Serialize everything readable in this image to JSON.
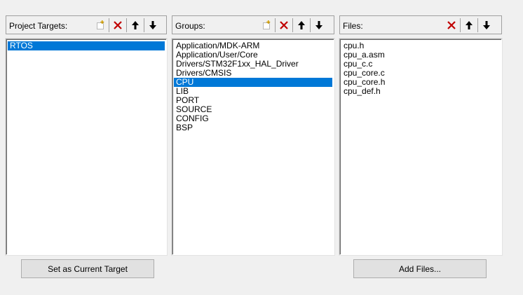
{
  "panels": {
    "targets": {
      "title": "Project Targets:",
      "items": [
        "RTOS"
      ],
      "selected_index": 0
    },
    "groups": {
      "title": "Groups:",
      "items": [
        "Application/MDK-ARM",
        "Application/User/Core",
        "Drivers/STM32F1xx_HAL_Driver",
        "Drivers/CMSIS",
        "CPU",
        "LIB",
        "PORT",
        "SOURCE",
        "CONFIG",
        "BSP"
      ],
      "selected_index": 4
    },
    "files": {
      "title": "Files:",
      "items": [
        "cpu.h",
        "cpu_a.asm",
        "cpu_c.c",
        "cpu_core.c",
        "cpu_core.h",
        "cpu_def.h"
      ],
      "selected_index": -1
    }
  },
  "buttons": {
    "set_current_target": "Set as Current Target",
    "add_files": "Add Files..."
  },
  "colors": {
    "selection": "#0078d7",
    "delete_icon": "#c00000",
    "background": "#f0f0f0"
  },
  "icons": {
    "new": "new-item-icon",
    "delete": "delete-icon",
    "up": "move-up-icon",
    "down": "move-down-icon"
  }
}
